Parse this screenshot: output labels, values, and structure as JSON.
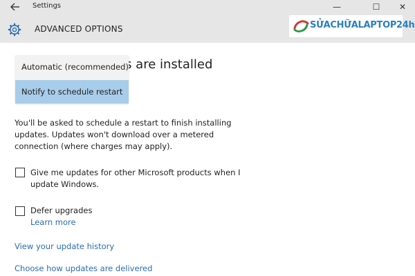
{
  "window": {
    "title": "Settings",
    "controls": {
      "minimize": "—",
      "maximize": "☐",
      "close": "✕"
    }
  },
  "header": {
    "page_title": "ADVANCED OPTIONS"
  },
  "watermark": {
    "text": "SỬACHỮALAPTOP24h",
    "icon": "brand-swirl-icon",
    "color": "#2a7fc2"
  },
  "section": {
    "heading_partial": "es are installed"
  },
  "restart_dropdown": {
    "options": [
      "Automatic (recommended)",
      "Notify to schedule restart"
    ],
    "selected_index": 1,
    "highlight_color": "#a8cdea"
  },
  "description": "You'll be asked to schedule a restart to finish installing updates. Updates won't download over a metered connection (where charges may apply).",
  "options": {
    "microsoft_updates": {
      "label": "Give me updates for other Microsoft products when I update Windows.",
      "checked": false
    },
    "defer_upgrades": {
      "label": "Defer upgrades",
      "checked": false,
      "link": "Learn more"
    }
  },
  "links": {
    "update_history": "View your update history",
    "delivery": "Choose how updates are delivered"
  },
  "colors": {
    "link": "#2b6cb3",
    "header_bg": "#e6e6e6"
  }
}
